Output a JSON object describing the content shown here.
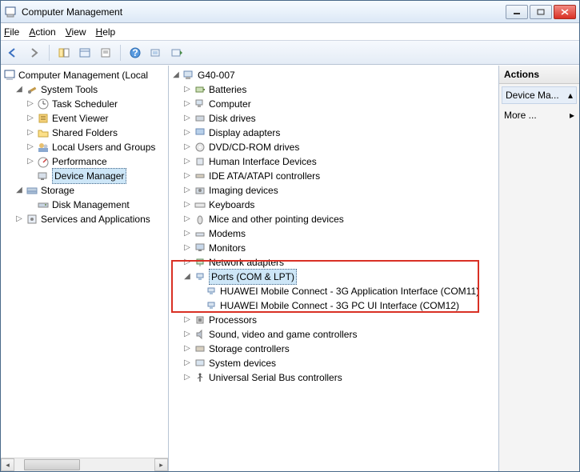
{
  "window": {
    "title": "Computer Management"
  },
  "menus": {
    "file": "File",
    "action": "Action",
    "view": "View",
    "help": "Help"
  },
  "left_tree": {
    "root": "Computer Management (Local",
    "system_tools": "System Tools",
    "task_scheduler": "Task Scheduler",
    "event_viewer": "Event Viewer",
    "shared_folders": "Shared Folders",
    "local_users": "Local Users and Groups",
    "performance": "Performance",
    "device_manager": "Device Manager",
    "storage": "Storage",
    "disk_management": "Disk Management",
    "services_apps": "Services and Applications"
  },
  "mid_tree": {
    "root": "G40-007",
    "batteries": "Batteries",
    "computer": "Computer",
    "disk_drives": "Disk drives",
    "display_adapters": "Display adapters",
    "dvd": "DVD/CD-ROM drives",
    "hid": "Human Interface Devices",
    "ide": "IDE ATA/ATAPI controllers",
    "imaging": "Imaging devices",
    "keyboards": "Keyboards",
    "mice": "Mice and other pointing devices",
    "modems": "Modems",
    "monitors": "Monitors",
    "network": "Network adapters",
    "ports": "Ports (COM & LPT)",
    "port_item1": "HUAWEI Mobile Connect - 3G Application Interface (COM11)",
    "port_item2": "HUAWEI Mobile Connect - 3G PC UI Interface (COM12)",
    "processors": "Processors",
    "sound": "Sound, video and game controllers",
    "storage_ctrl": "Storage controllers",
    "system_devices": "System devices",
    "usb": "Universal Serial Bus controllers"
  },
  "actions": {
    "header": "Actions",
    "device_ma": "Device Ma...",
    "more": "More ..."
  }
}
